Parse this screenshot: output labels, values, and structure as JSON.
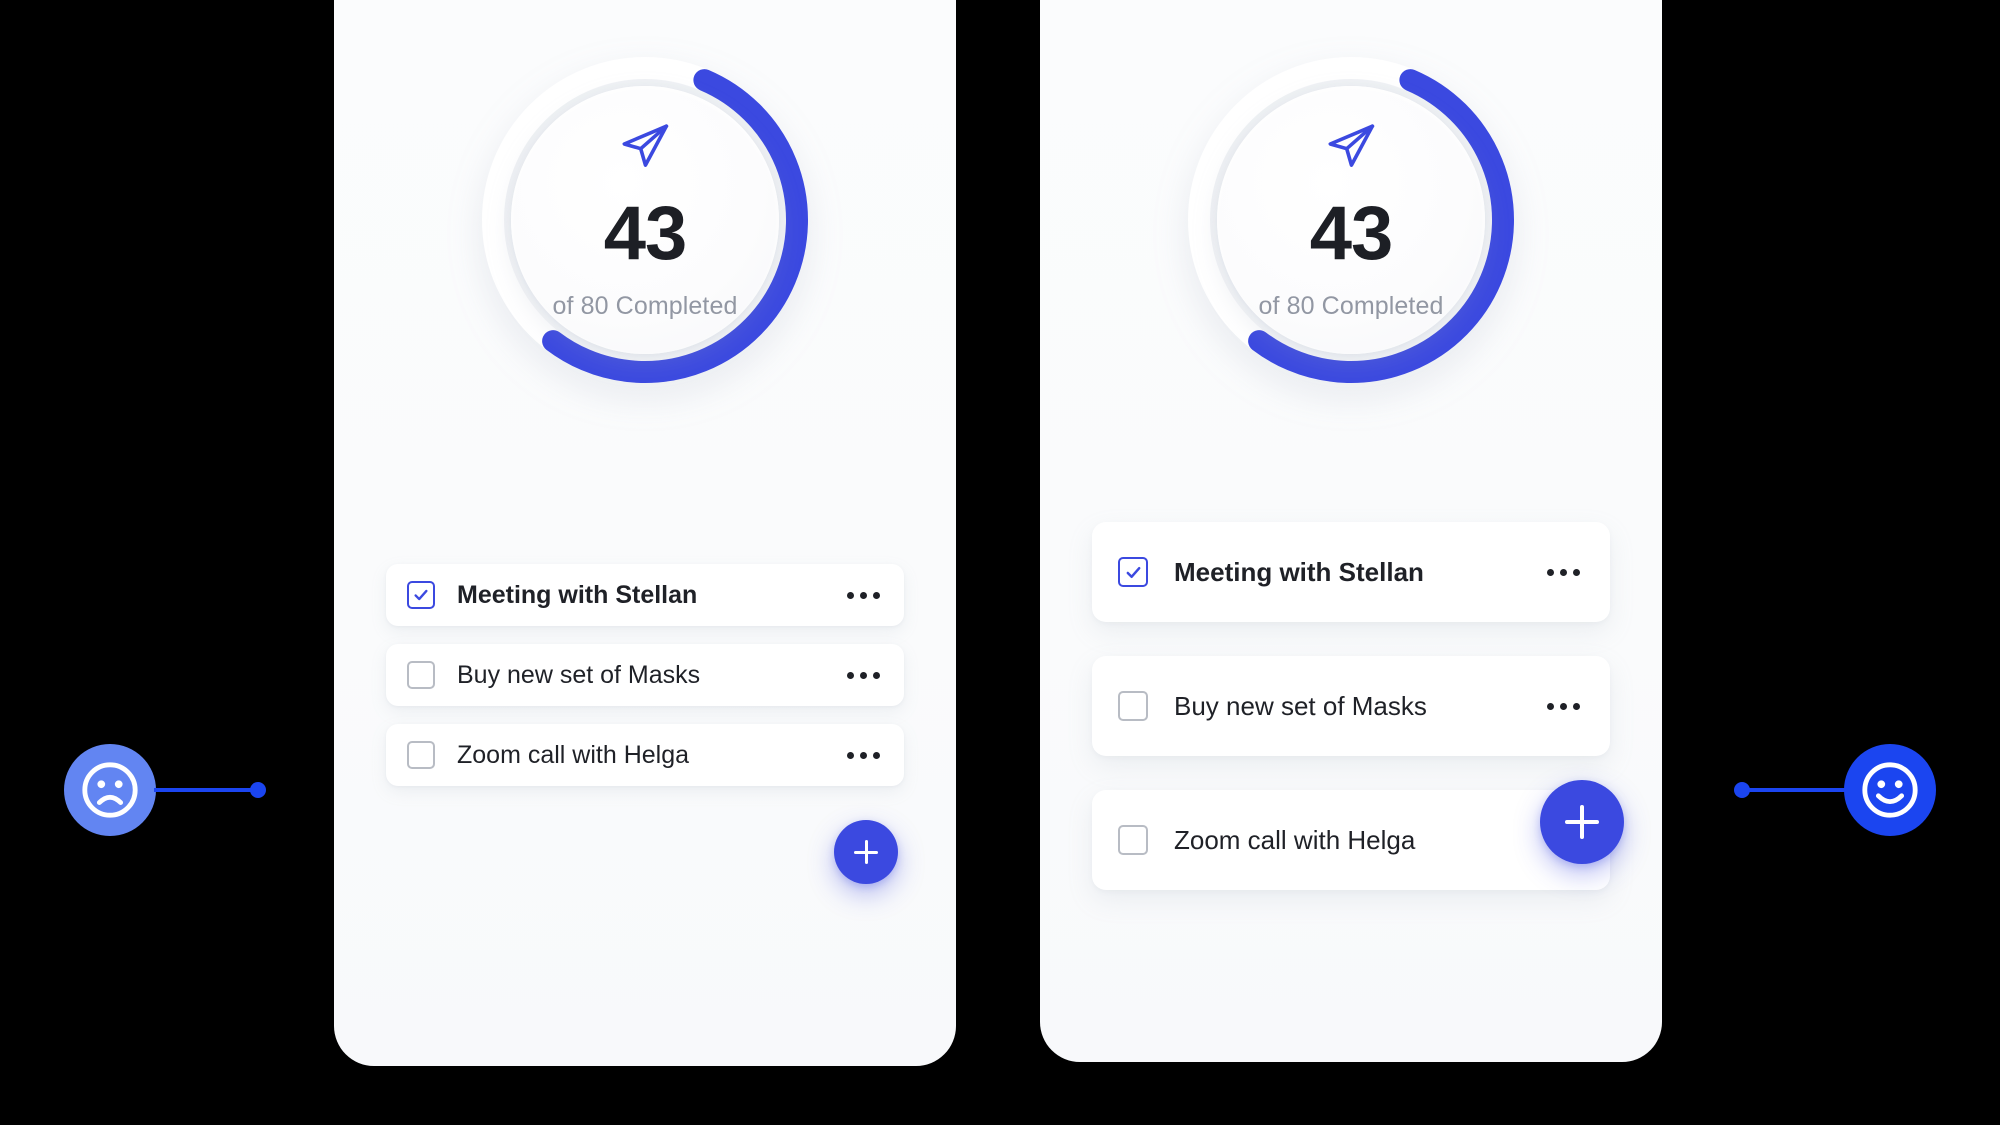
{
  "theme": {
    "background": "#000000",
    "card_background": "#fafbfc",
    "accent_blue": "#3b49e0",
    "marker_blue": "#1b45f0",
    "marker_blue_muted": "#6285f2",
    "text_primary": "#1f2127",
    "text_muted": "#9297a3",
    "checkbox_border": "#b8bcc4"
  },
  "cards": [
    {
      "id": "card-compact",
      "progress": {
        "count": "43",
        "caption": "of 80 Completed",
        "completed": 43,
        "total": 80,
        "percent": 54,
        "icon": "paper-plane-icon"
      },
      "tasks": [
        {
          "label": "Meeting with Stellan",
          "checked": true,
          "menu": "more-options-icon"
        },
        {
          "label": "Buy new set of Masks",
          "checked": false,
          "menu": "more-options-icon"
        },
        {
          "label": "Zoom call with Helga",
          "checked": false,
          "menu": "more-options-icon"
        }
      ],
      "fab": {
        "icon": "plus-icon",
        "label": "Add task"
      }
    },
    {
      "id": "card-spacious",
      "progress": {
        "count": "43",
        "caption": "of 80 Completed",
        "completed": 43,
        "total": 80,
        "percent": 54,
        "icon": "paper-plane-icon"
      },
      "tasks": [
        {
          "label": "Meeting with Stellan",
          "checked": true,
          "menu": "more-options-icon"
        },
        {
          "label": "Buy new set of Masks",
          "checked": false,
          "menu": "more-options-icon"
        },
        {
          "label": "Zoom call with Helga",
          "checked": false,
          "menu": null
        }
      ],
      "fab": {
        "icon": "plus-icon",
        "label": "Add task"
      }
    }
  ],
  "markers": [
    {
      "id": "marker-negative",
      "icon": "sad-face-icon",
      "side": "left",
      "color": "#6285f2"
    },
    {
      "id": "marker-positive",
      "icon": "happy-face-icon",
      "side": "right",
      "color": "#1b45f0"
    }
  ]
}
